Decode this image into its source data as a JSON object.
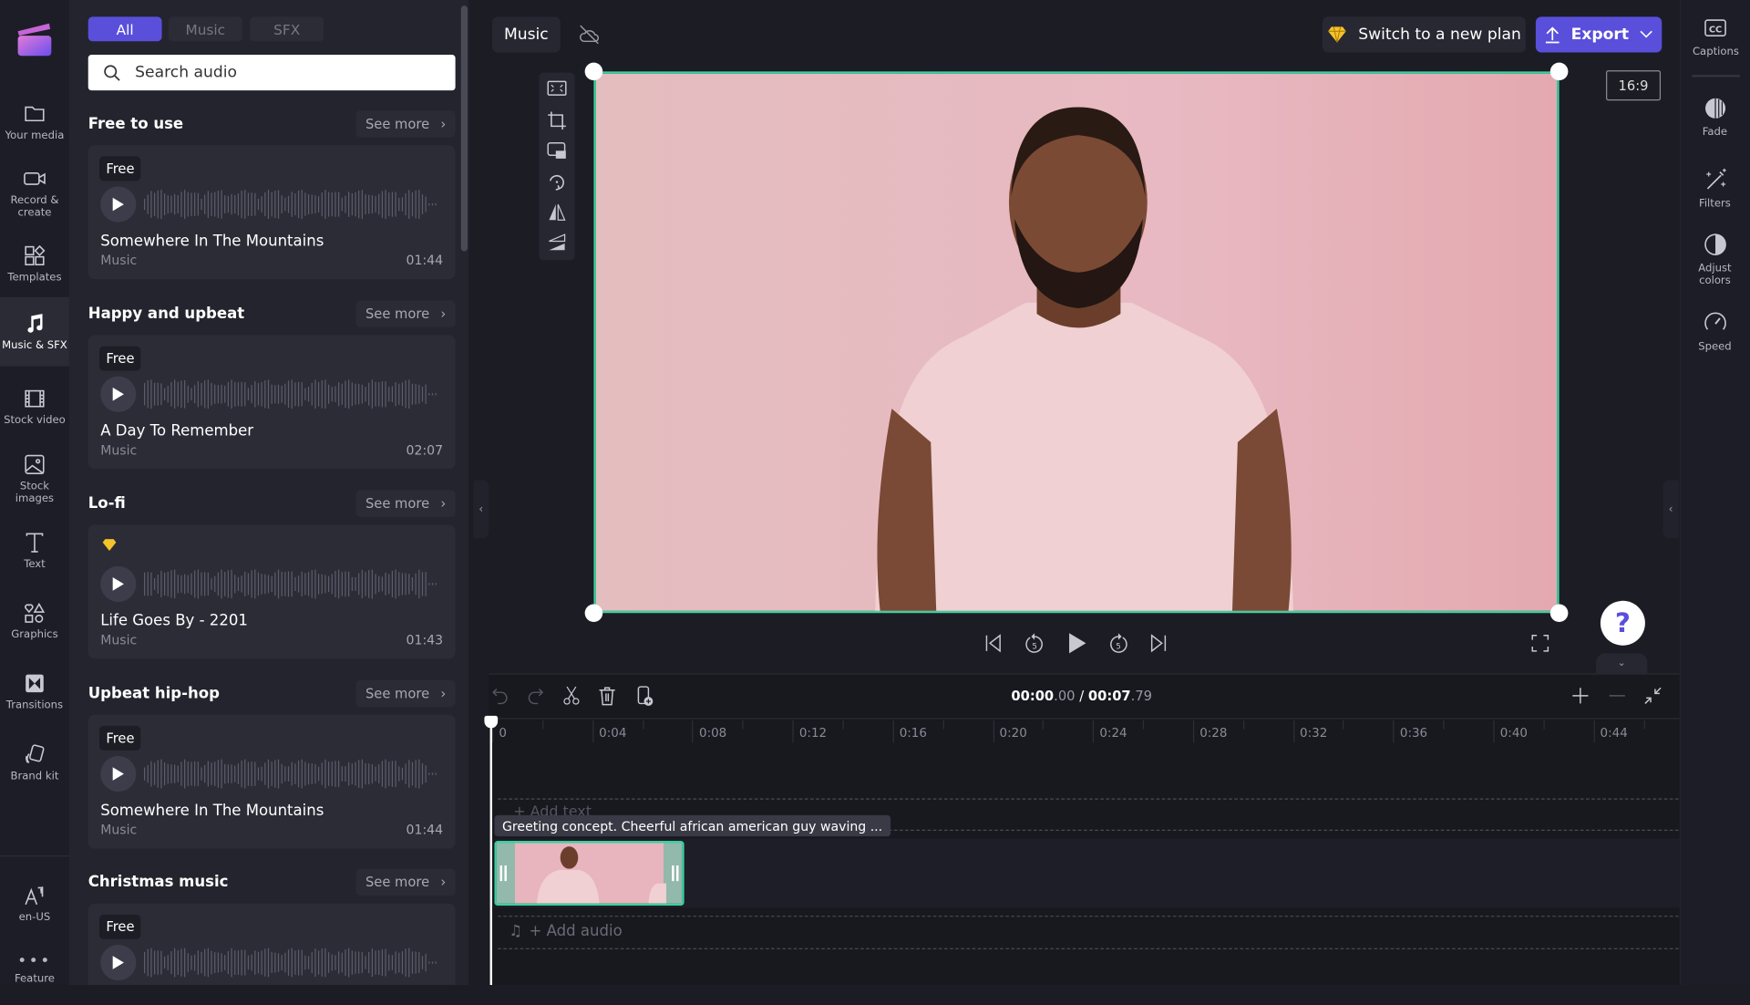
{
  "nav": {
    "items": [
      {
        "label": "Your media",
        "icon": "folder-icon"
      },
      {
        "label": "Record & create",
        "icon": "camera-icon"
      },
      {
        "label": "Templates",
        "icon": "templates-icon"
      },
      {
        "label": "Music & SFX",
        "icon": "music-note-icon",
        "active": true
      },
      {
        "label": "Stock video",
        "icon": "film-icon"
      },
      {
        "label": "Stock images",
        "icon": "image-icon"
      },
      {
        "label": "Text",
        "icon": "text-icon"
      },
      {
        "label": "Graphics",
        "icon": "shapes-icon"
      },
      {
        "label": "Transitions",
        "icon": "transition-icon"
      },
      {
        "label": "Brand kit",
        "icon": "brand-kit-icon"
      }
    ],
    "language": "en-US",
    "feature": "Feature"
  },
  "panel": {
    "tabs": [
      "All",
      "Music",
      "SFX"
    ],
    "active_tab": "All",
    "search_placeholder": "Search audio",
    "see_more": "See more",
    "sections": [
      {
        "title": "Free to use",
        "card": {
          "badge": "Free",
          "title": "Somewhere In The Mountains",
          "type": "Music",
          "duration": "01:44"
        }
      },
      {
        "title": "Happy and upbeat",
        "card": {
          "badge": "Free",
          "title": "A Day To Remember",
          "type": "Music",
          "duration": "02:07"
        }
      },
      {
        "title": "Lo-fi",
        "card": {
          "badge": "",
          "premium": true,
          "title": "Life Goes By - 2201",
          "type": "Music",
          "duration": "01:43"
        }
      },
      {
        "title": "Upbeat hip-hop",
        "card": {
          "badge": "Free",
          "title": "Somewhere In The Mountains",
          "type": "Music",
          "duration": "01:44"
        }
      },
      {
        "title": "Christmas music",
        "card": {
          "badge": "Free"
        }
      }
    ]
  },
  "header": {
    "project_name": "Music",
    "upgrade_label": "Switch to a new plan",
    "export_label": "Export",
    "aspect_ratio": "16:9"
  },
  "right_nav": {
    "items": [
      {
        "label": "Captions",
        "icon": "captions-icon"
      },
      {
        "label": "Fade",
        "icon": "fade-icon"
      },
      {
        "label": "Filters",
        "icon": "filters-icon"
      },
      {
        "label": "Adjust colors",
        "icon": "adjust-colors-icon"
      },
      {
        "label": "Speed",
        "icon": "speed-icon"
      }
    ]
  },
  "timeline": {
    "time_current": "00:00",
    "time_current_frac": ".00",
    "separator": "/",
    "time_total": "00:07",
    "time_total_frac": ".79",
    "ruler": [
      "0",
      "0:04",
      "0:08",
      "0:12",
      "0:16",
      "0:20",
      "0:24",
      "0:28",
      "0:32",
      "0:36",
      "0:40",
      "0:44"
    ],
    "clip_title": "Greeting concept. Cheerful african american guy waving ...",
    "add_text": "+ Add text",
    "add_audio": "+ Add audio"
  },
  "colors": {
    "accent": "#5a4fdb",
    "selection": "#3ecf9f",
    "premium": "#f5c22b"
  }
}
